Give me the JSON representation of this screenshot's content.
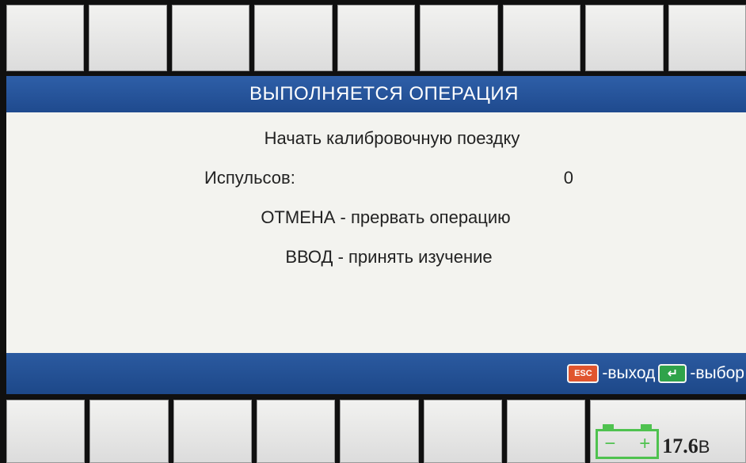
{
  "header": {
    "title": "ВЫПОЛНЯЕТСЯ ОПЕРАЦИЯ"
  },
  "main": {
    "line1": "Начать калибровочную поездку",
    "pulse_label": "Испульсов:",
    "pulse_value": "0",
    "line3": "ОТМЕНА - прервать операцию",
    "line4": "ВВОД - принять изучение"
  },
  "status_bar": {
    "esc_icon_label": "ESC",
    "esc_hint": "-выход",
    "enter_icon_label": "↵",
    "enter_hint": "-выбор"
  },
  "battery": {
    "voltage": "17.6",
    "unit": "В",
    "icon": "battery-icon"
  },
  "colors": {
    "title_bar": "#1f4a8e",
    "panel": "#f3f3ef",
    "esc_icon": "#e0552e",
    "enter_icon": "#2fa34a",
    "battery": "#4fc24f"
  }
}
